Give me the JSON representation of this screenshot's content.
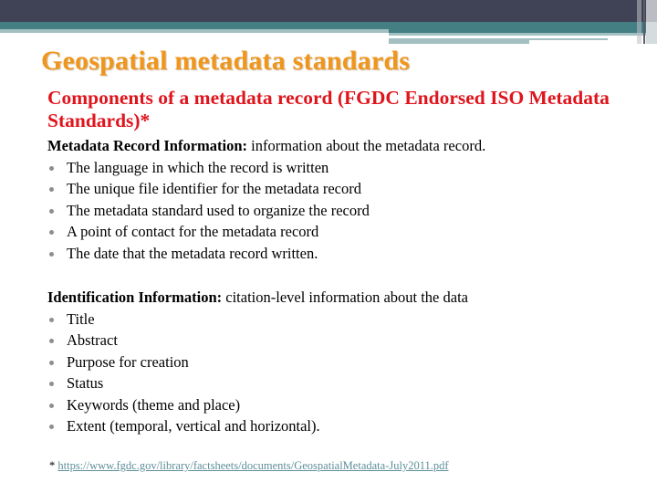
{
  "slide": {
    "title": "Geospatial metadata standards",
    "subtitle": "Components of a metadata record (FGDC Endorsed ISO Metadata Standards)*",
    "colors": {
      "title": "#f0961c",
      "subtitle": "#e0141c",
      "header_dark": "#404356",
      "header_teal": "#437f83",
      "header_light": "#a3bfc1",
      "link": "#5e8f9a",
      "bullet": "#8e8e8e"
    }
  },
  "sections": [
    {
      "heading_bold": "Metadata Record Information:",
      "heading_text": " information about the metadata record.",
      "bullets": [
        "The language in which the record is written",
        "The unique file identifier for the metadata record",
        "The metadata standard used to organize the record",
        "A point of contact for the metadata record",
        "The date that the metadata record written."
      ]
    },
    {
      "heading_bold": "Identification Information:",
      "heading_text": " citation-level information about the data",
      "bullets": [
        "Title",
        "Abstract",
        "Purpose for creation",
        "Status",
        "Keywords (theme and place)",
        "Extent (temporal, vertical and horizontal)."
      ]
    }
  ],
  "footnote": {
    "marker": "* ",
    "link_text": "https://www.fgdc.gov/library/factsheets/documents/GeospatialMetadata-July2011.pdf"
  }
}
